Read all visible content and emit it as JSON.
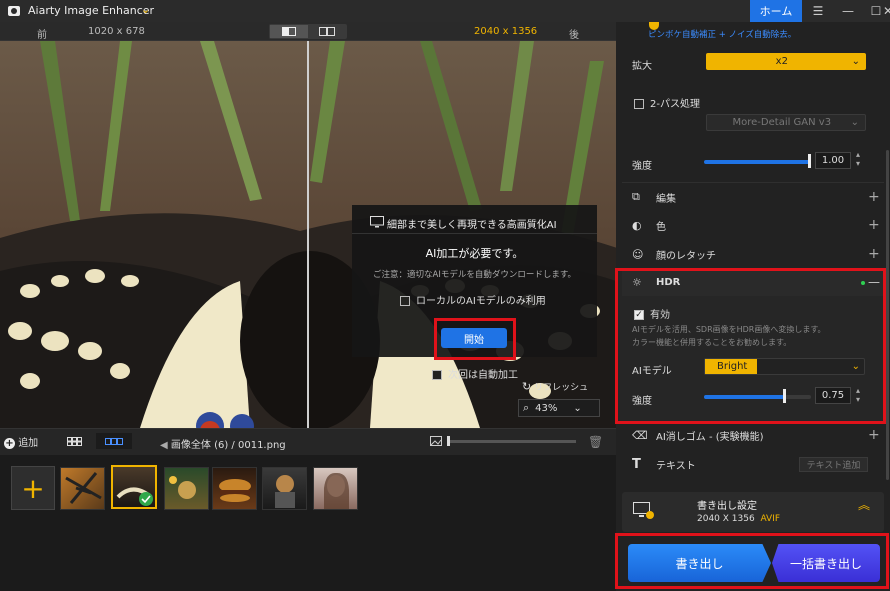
{
  "app": {
    "title": "Aiarty Image Enhancer",
    "home_label": "ホーム"
  },
  "compare": {
    "before_label": "前",
    "before_size": "1020 x 678",
    "after_size": "2040 x 1356",
    "after_label": "後"
  },
  "dialog": {
    "title": "細部まで美しく再現できる高画質化AI",
    "headline": "AI加工が必要です。",
    "note": "ご注意：適切なAIモデルを自動ダウンロードします。",
    "local_only_label": "ローカルのAIモデルのみ利用",
    "start_label": "開始"
  },
  "viewer": {
    "auto_process_label": "次回は自動加工",
    "refresh_label": "リフレッシュ",
    "zoom": "43%"
  },
  "bottombar": {
    "add_label": "追加",
    "crumb_all": "画像全体 (6)",
    "crumb_sep": "/",
    "crumb_file": "0011.png"
  },
  "thumbnails": [
    "tiger",
    "butterfly",
    "forest-creature",
    "burger",
    "warrior-cat",
    "woman-portrait"
  ],
  "right_panel": {
    "top_note": "ピンボケ自動補正 + ノイズ自動除去。",
    "scale_label": "拡大",
    "scale_value": "x2",
    "twopass_label": "2-パス処理",
    "twopass_model": "More-Detail GAN  v3",
    "strength_label": "強度",
    "strength_value": "1.00",
    "strength_fraction": 1.0,
    "sections": {
      "edit": "編集",
      "color": "色",
      "face": "顔のレタッチ",
      "hdr": "HDR",
      "eraser": "AI消しゴム - (実験機能)",
      "text": "テキスト"
    },
    "hdr": {
      "enabled_label": "有効",
      "desc1": "AIモデルを活用、SDR画像をHDR画像へ変換します。",
      "desc2": "カラー機能と併用することをお勧めします。",
      "model_label": "AIモデル",
      "model_value": "Bright",
      "strength_label": "強度",
      "strength_value": "0.75",
      "strength_fraction": 0.75
    },
    "text_add_label": "テキスト追加",
    "export_settings": {
      "title": "書き出し設定",
      "size": "2040 X 1356",
      "format": "AVIF"
    },
    "export_label": "書き出し",
    "batch_export_label": "一括書き出し"
  },
  "colors": {
    "accent": "#1f73e5",
    "yellow": "#f0b400",
    "highlight": "#e0121a",
    "batch": "#4a40e8"
  }
}
